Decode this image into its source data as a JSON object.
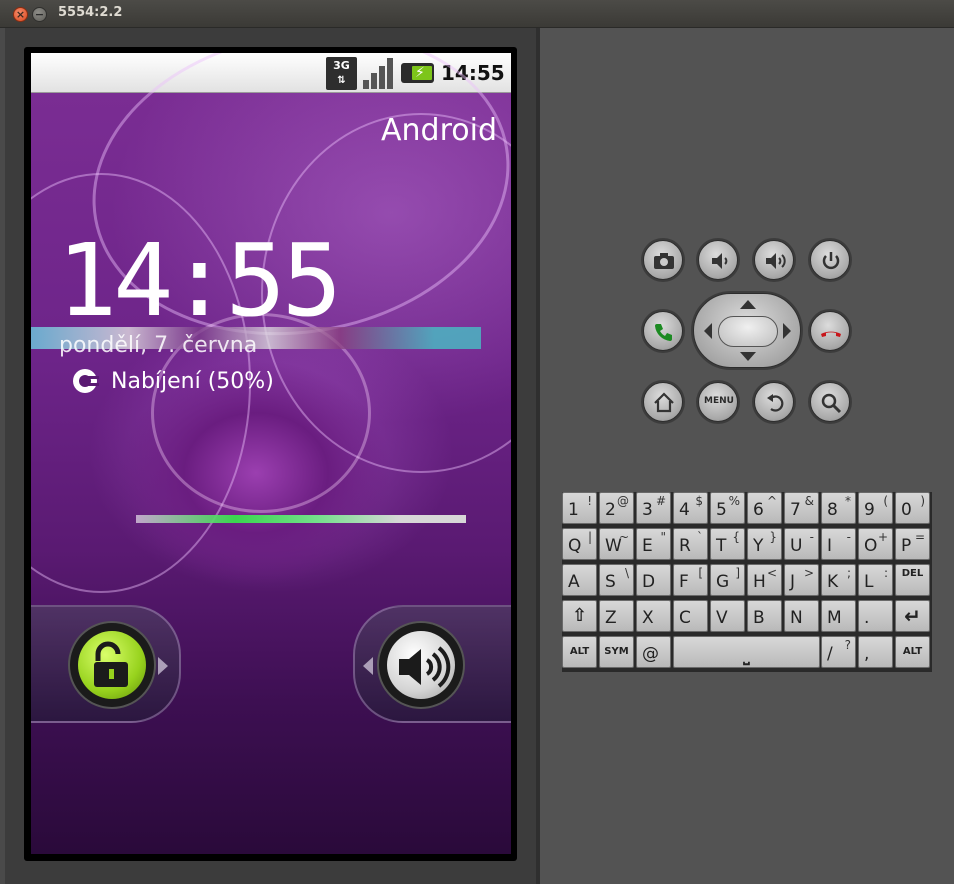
{
  "window": {
    "title": "5554:2.2",
    "close_label": "×",
    "minimize_label": "−"
  },
  "status_bar": {
    "network": "3G",
    "time": "14:55",
    "icons": [
      "3g-data-icon",
      "signal-strength-icon",
      "battery-charging-icon"
    ]
  },
  "lockscreen": {
    "carrier": "Android",
    "clock": "14:55",
    "date": "pondělí, 7. června",
    "charging_text": "Nabíjení (50%)",
    "unlock_tab": "unlock-icon",
    "sound_tab": "sound-on-icon"
  },
  "hw_buttons": {
    "row1": [
      "camera-icon",
      "volume-down-icon",
      "volume-up-icon",
      "power-icon"
    ],
    "row2": [
      "call-icon",
      "dpad",
      "end-call-icon"
    ],
    "row3": [
      "home-icon",
      "menu",
      "back-icon",
      "search-icon"
    ],
    "menu_label": "MENU"
  },
  "keyboard": {
    "row1": [
      {
        "m": "1",
        "a": "!"
      },
      {
        "m": "2",
        "a": "@"
      },
      {
        "m": "3",
        "a": "#"
      },
      {
        "m": "4",
        "a": "$"
      },
      {
        "m": "5",
        "a": "%"
      },
      {
        "m": "6",
        "a": "^"
      },
      {
        "m": "7",
        "a": "&"
      },
      {
        "m": "8",
        "a": "*"
      },
      {
        "m": "9",
        "a": "("
      },
      {
        "m": "0",
        "a": ")"
      }
    ],
    "row2": [
      {
        "m": "Q",
        "a": "|"
      },
      {
        "m": "W",
        "a": "~"
      },
      {
        "m": "E",
        "a": "\""
      },
      {
        "m": "R",
        "a": "`"
      },
      {
        "m": "T",
        "a": "{"
      },
      {
        "m": "Y",
        "a": "}"
      },
      {
        "m": "U",
        "a": "-"
      },
      {
        "m": "I",
        "a": "-"
      },
      {
        "m": "O",
        "a": "+"
      },
      {
        "m": "P",
        "a": "="
      }
    ],
    "row3": [
      {
        "m": "A",
        "a": ""
      },
      {
        "m": "S",
        "a": "\\"
      },
      {
        "m": "D",
        "a": ""
      },
      {
        "m": "F",
        "a": "["
      },
      {
        "m": "G",
        "a": "]"
      },
      {
        "m": "H",
        "a": "<"
      },
      {
        "m": "J",
        "a": ">"
      },
      {
        "m": "K",
        "a": ";"
      },
      {
        "m": "L",
        "a": ":"
      }
    ],
    "del_label": "DEL",
    "row4": [
      {
        "m": "Z",
        "a": ""
      },
      {
        "m": "X",
        "a": ""
      },
      {
        "m": "C",
        "a": ""
      },
      {
        "m": "V",
        "a": ""
      },
      {
        "m": "B",
        "a": ""
      },
      {
        "m": "N",
        "a": ""
      },
      {
        "m": "M",
        "a": ""
      },
      {
        "m": ".",
        "a": ""
      }
    ],
    "alt_label": "ALT",
    "sym_label": "SYM",
    "at_label": "@",
    "slash": {
      "m": "/",
      "a": "?"
    },
    "comma": ",",
    "alt_right_label": "ALT"
  }
}
